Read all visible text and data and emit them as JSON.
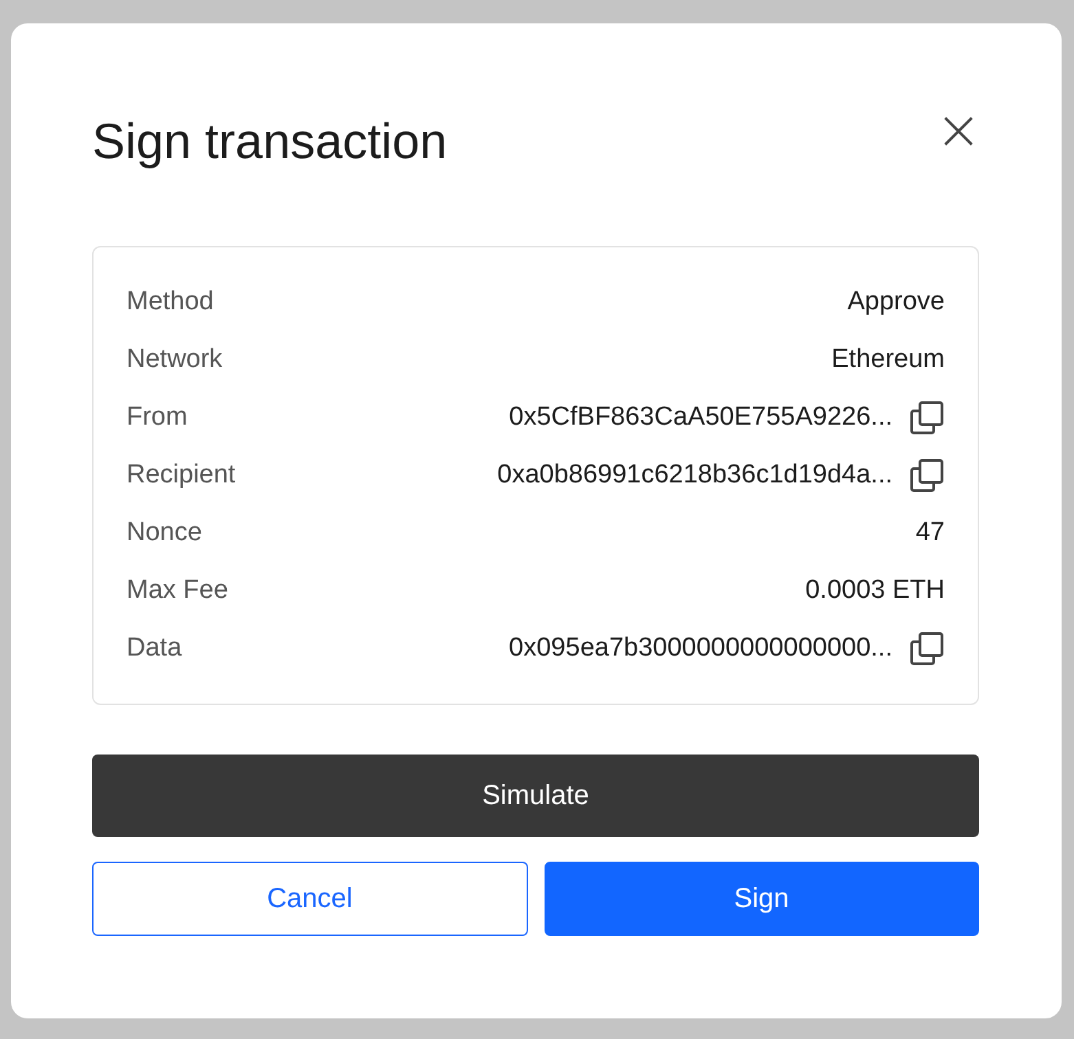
{
  "dialog": {
    "title": "Sign transaction",
    "close": "×"
  },
  "details": [
    {
      "label": "Method",
      "value": "Approve",
      "copyable": false
    },
    {
      "label": "Network",
      "value": "Ethereum",
      "copyable": false
    },
    {
      "label": "From",
      "value": "0x5CfBF863CaA50E755A9226...",
      "copyable": true
    },
    {
      "label": "Recipient",
      "value": "0xa0b86991c6218b36c1d19d4a...",
      "copyable": true
    },
    {
      "label": "Nonce",
      "value": "47",
      "copyable": false
    },
    {
      "label": "Max Fee",
      "value": "0.0003 ETH",
      "copyable": false
    },
    {
      "label": "Data",
      "value": "0x095ea7b3000000000000000...",
      "copyable": true
    }
  ],
  "buttons": {
    "simulate": "Simulate",
    "cancel": "Cancel",
    "sign": "Sign"
  }
}
